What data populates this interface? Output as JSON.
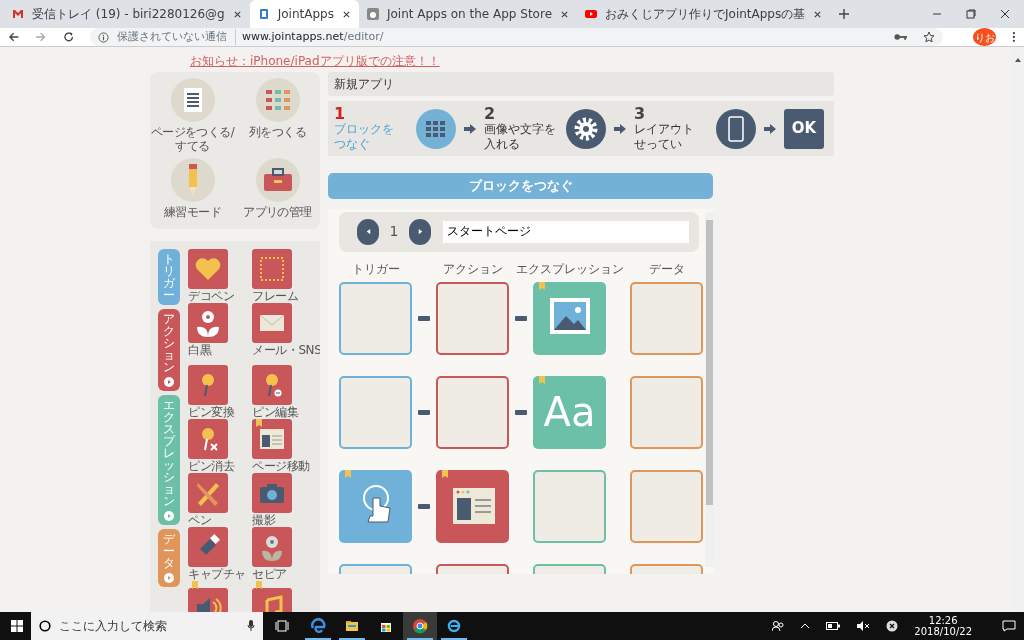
{
  "browser": {
    "tabs": [
      {
        "title": "受信トレイ (19) - biri2280126@g",
        "selected": false
      },
      {
        "title": "JointApps",
        "selected": true
      },
      {
        "title": "Joint Apps on the App Store",
        "selected": false
      },
      {
        "title": "おみくじアプリ作りでJointAppsの基",
        "selected": false
      }
    ],
    "security": "保護されていない通信",
    "url_host": "www.jointapps.net",
    "url_path": "/editor/",
    "profile": "りお"
  },
  "notice": "お知らせ：iPhone/iPadアプリ版での注意！！",
  "tools": [
    {
      "label": "ページをつくる/すてる"
    },
    {
      "label": "列をつくる"
    },
    {
      "label": "練習モード"
    },
    {
      "label": "アプリの管理"
    }
  ],
  "categories": [
    {
      "label": "トリガー",
      "color": "#6fb1d8",
      "play": false
    },
    {
      "label": "アクション",
      "color": "#c9575a",
      "play": true
    },
    {
      "label": "エクスプレッション",
      "color": "#6cc0a8",
      "play": true
    },
    {
      "label": "データ",
      "color": "#e0965a",
      "play": true
    }
  ],
  "block_groups": [
    [
      {
        "label": "デコペン",
        "bookmark": false
      },
      {
        "label": "フレーム",
        "bookmark": false
      },
      {
        "label": "白黒",
        "bookmark": false
      },
      {
        "label": "メール・SNS",
        "bookmark": false
      }
    ],
    [
      {
        "label": "ピン変換",
        "bookmark": false
      },
      {
        "label": "ピン編集",
        "bookmark": false
      },
      {
        "label": "ピン消去",
        "bookmark": false
      },
      {
        "label": "ページ移動",
        "bookmark": true
      },
      {
        "label": "ペン",
        "bookmark": false
      },
      {
        "label": "撮影",
        "bookmark": false
      },
      {
        "label": "キャプチャ",
        "bookmark": false
      },
      {
        "label": "セピア",
        "bookmark": false
      },
      {
        "bookmark": true
      },
      {
        "bookmark": true
      }
    ]
  ],
  "app_name": "新規アプリ",
  "steps": [
    {
      "number": "1",
      "label": "ブロックをつなぐ",
      "selected": true
    },
    {
      "number": "2",
      "label": "画像や文字を入れる",
      "selected": false
    },
    {
      "number": "3",
      "label": "レイアウトせってい",
      "selected": false
    }
  ],
  "ok_button": "OK",
  "section_title": "ブロックをつなぐ",
  "page_nav": {
    "number": "1",
    "page_name": "スタートページ"
  },
  "columns": [
    {
      "label": "トリガー",
      "color": "#6fb1d8"
    },
    {
      "label": "アクション",
      "color": "#c9575a"
    },
    {
      "label": "エクスプレッション",
      "color": "#6cc0a8"
    },
    {
      "label": "データ",
      "color": "#e0965a"
    }
  ],
  "grid_rows": [
    {
      "links": [
        true,
        true,
        false
      ],
      "cells": [
        {
          "kind": "empty"
        },
        {
          "kind": "empty"
        },
        {
          "kind": "image",
          "bookmark": true
        },
        {
          "kind": "empty"
        }
      ]
    },
    {
      "links": [
        true,
        true,
        false
      ],
      "cells": [
        {
          "kind": "empty"
        },
        {
          "kind": "empty"
        },
        {
          "kind": "text",
          "text": "Aa",
          "bookmark": true
        },
        {
          "kind": "empty"
        }
      ]
    },
    {
      "links": [
        true,
        false,
        false
      ],
      "cells": [
        {
          "kind": "touch",
          "bookmark": true
        },
        {
          "kind": "page",
          "bookmark": true
        },
        {
          "kind": "empty"
        },
        {
          "kind": "empty"
        }
      ]
    },
    {
      "links": [
        false,
        false,
        false
      ],
      "cells": [
        {
          "kind": "empty"
        },
        {
          "kind": "empty"
        },
        {
          "kind": "empty"
        },
        {
          "kind": "empty"
        }
      ]
    }
  ],
  "taskbar": {
    "search_placeholder": "ここに入力して検索",
    "apps": [
      {
        "running": true,
        "selected": false
      },
      {
        "running": true,
        "selected": false
      },
      {
        "running": false,
        "selected": false
      },
      {
        "running": true,
        "selected": true
      },
      {
        "running": true,
        "selected": false
      }
    ],
    "time": "12:26",
    "date": "2018/10/22"
  }
}
